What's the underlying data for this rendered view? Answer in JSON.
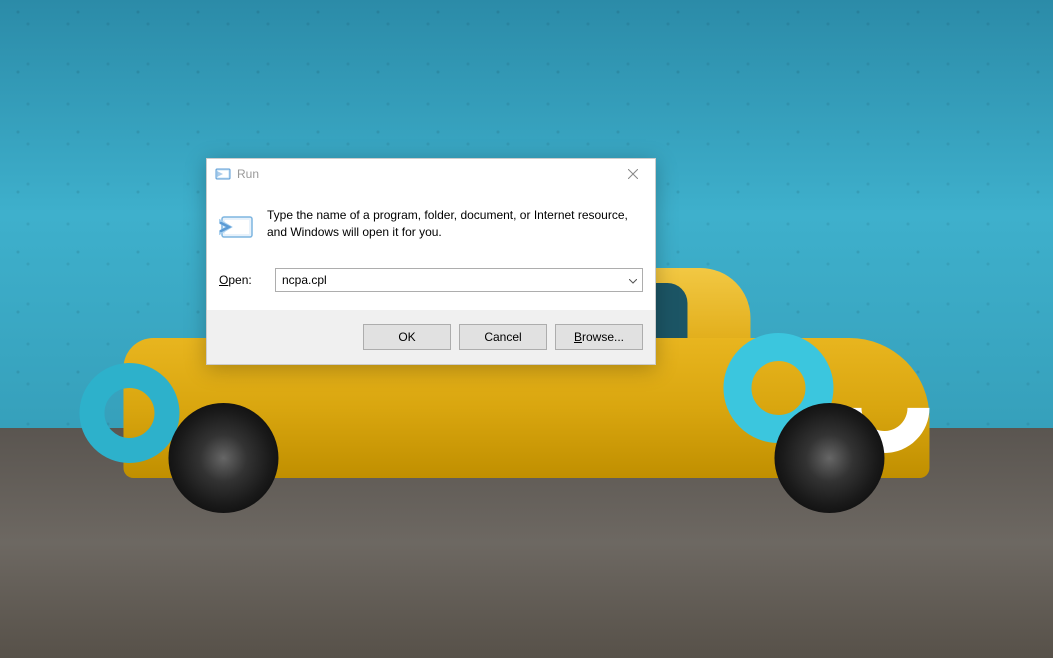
{
  "dialog": {
    "title": "Run",
    "description": "Type the name of a program, folder, document, or Internet resource, and Windows will open it for you.",
    "open_label_prefix": "O",
    "open_label_rest": "pen:",
    "input_value": "ncpa.cpl",
    "buttons": {
      "ok": "OK",
      "cancel": "Cancel",
      "browse_prefix": "B",
      "browse_rest": "rowse..."
    }
  }
}
